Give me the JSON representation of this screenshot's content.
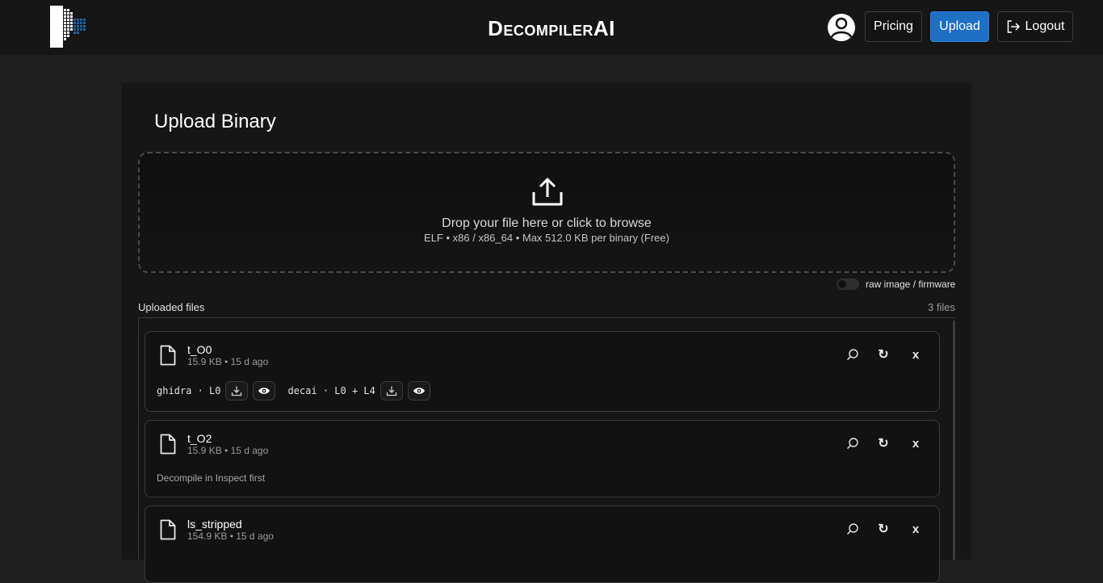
{
  "header": {
    "brand": "DecompilerAI",
    "pricing_label": "Pricing",
    "upload_label": "Upload",
    "logout_label": "Logout"
  },
  "upload": {
    "title": "Upload Binary",
    "drop_text": "Drop your file here or click to browse",
    "drop_subtext": "ELF • x86 / x86_64 • Max 512.0 KB per binary (Free)",
    "raw_toggle_label": "raw image / firmware",
    "raw_toggle_on": false
  },
  "files": {
    "label": "Uploaded files",
    "count": "3 files",
    "items": [
      {
        "name": "t_O0",
        "meta": "15.9 KB • 15 d ago",
        "outputs": [
          {
            "label": "ghidra · L0"
          },
          {
            "label": "decai · L0 + L4"
          }
        ]
      },
      {
        "name": "t_O2",
        "meta": "15.9 KB • 15 d ago",
        "hint": "Decompile in Inspect first"
      },
      {
        "name": "ls_stripped",
        "meta": "154.9 KB • 15 d ago"
      }
    ]
  },
  "icons": {
    "close_glyph": "x",
    "redo_glyph": "↻"
  },
  "colors": {
    "accent": "#1f6fc4",
    "background": "#1e1e1e",
    "panel": "#161616",
    "logo_blue": "#1f5f99"
  }
}
